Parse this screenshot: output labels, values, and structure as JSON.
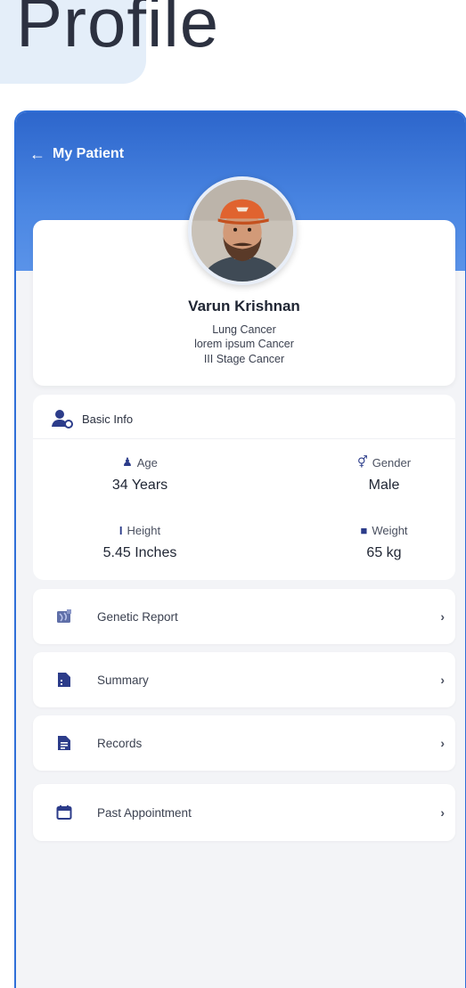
{
  "page": {
    "heading": "Profile"
  },
  "header": {
    "back_label": "My Patient",
    "back_icon": "arrow-left-icon",
    "bg_color": "#2d66cc"
  },
  "patient": {
    "name": "Varun Krishnan",
    "diagnoses": [
      "Lung Cancer",
      "lorem ipsum Cancer",
      "III Stage Cancer"
    ]
  },
  "basic_info": {
    "title": "Basic Info",
    "age": {
      "label": "Age",
      "value": "34 Years",
      "icon": "person-icon"
    },
    "gender": {
      "label": "Gender",
      "value": "Male",
      "icon": "gender-icon"
    },
    "height": {
      "label": "Height",
      "value": "5.45 Inches",
      "icon": "height-icon"
    },
    "weight": {
      "label": "Weight",
      "value": "65 kg",
      "icon": "weight-icon"
    }
  },
  "menu": [
    {
      "label": "Genetic Report",
      "icon": "genetic-report-icon"
    },
    {
      "label": "Summary",
      "icon": "summary-icon"
    },
    {
      "label": "Records",
      "icon": "records-icon"
    },
    {
      "label": "Past Appointment",
      "icon": "calendar-icon"
    }
  ],
  "menu_chevron": "›",
  "colors": {
    "accent": "#2f6fd8",
    "icon": "#2c3c8a",
    "background": "#f3f4f7"
  }
}
